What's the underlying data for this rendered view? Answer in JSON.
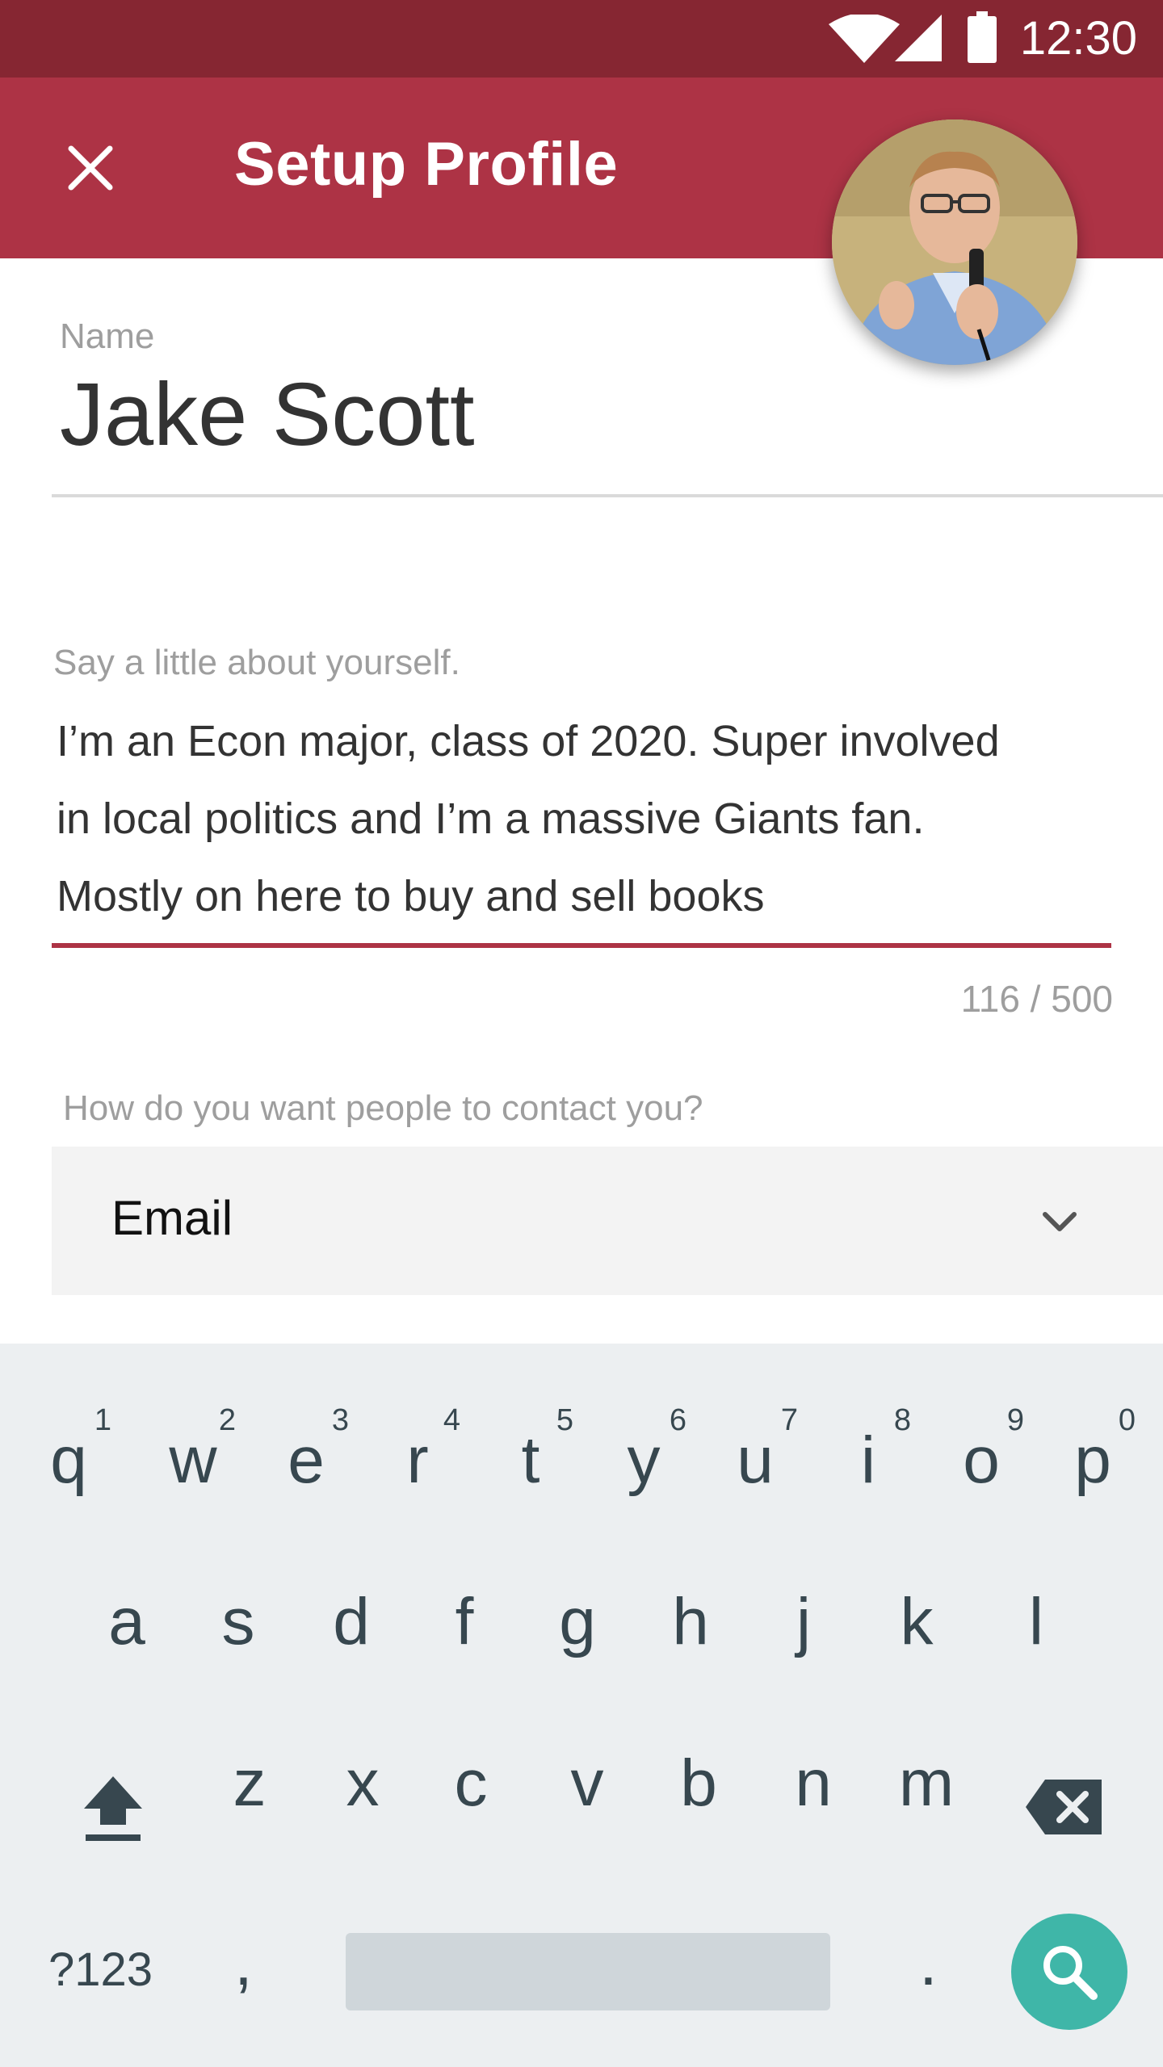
{
  "status_bar": {
    "time": "12:30",
    "icons": [
      "wifi-icon",
      "cell-signal-icon",
      "battery-icon"
    ]
  },
  "app_bar": {
    "title": "Setup Profile",
    "close_icon": "close-icon"
  },
  "profile": {
    "name_label": "Name",
    "name_value": "Jake Scott",
    "bio_label": "Say a little about yourself.",
    "bio_lines": [
      "I’m an Econ major, class of 2020. Super involved",
      "in local politics and I’m a massive Giants fan.",
      "Mostly on here to buy and sell books"
    ],
    "bio_counter": "116 / 500",
    "contact_label": "How do you want people to contact you?",
    "contact_value": "Email"
  },
  "keyboard": {
    "row1": [
      {
        "key": "q",
        "num": "1"
      },
      {
        "key": "w",
        "num": "2"
      },
      {
        "key": "e",
        "num": "3"
      },
      {
        "key": "r",
        "num": "4"
      },
      {
        "key": "t",
        "num": "5"
      },
      {
        "key": "y",
        "num": "6"
      },
      {
        "key": "u",
        "num": "7"
      },
      {
        "key": "i",
        "num": "8"
      },
      {
        "key": "o",
        "num": "9"
      },
      {
        "key": "p",
        "num": "0"
      }
    ],
    "row2": [
      "a",
      "s",
      "d",
      "f",
      "g",
      "h",
      "j",
      "k",
      "l"
    ],
    "row3": [
      "z",
      "x",
      "c",
      "v",
      "b",
      "n",
      "m"
    ],
    "symbols_label": "?123",
    "comma": ",",
    "period": "."
  },
  "colors": {
    "status_bar": "#862632",
    "app_bar": "#ad3345",
    "accent_line": "#ad3345",
    "keyboard_bg": "#eceff1",
    "search_key": "#3fb6a8"
  }
}
